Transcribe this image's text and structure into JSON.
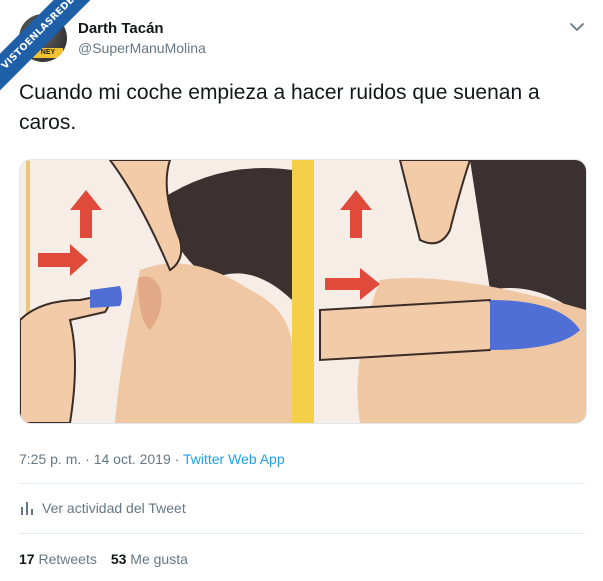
{
  "watermark": "VISTOENLASREDES",
  "user": {
    "name": "Darth Tacán",
    "handle": "@SuperManuMolina",
    "avatar_tag": "NEY"
  },
  "tweet": {
    "text": "Cuando mi coche empieza a hacer ruidos que suenan a caros."
  },
  "meta": {
    "time_date": "7:25 p. m. · 14 oct. 2019 · ",
    "app": "Twitter Web App"
  },
  "activity_label": "Ver actividad del Tweet",
  "stats": {
    "retweets_count": "17",
    "retweets_label": "Retweets",
    "likes_count": "53",
    "likes_label": "Me gusta"
  },
  "icons": [
    "chevron-down-icon",
    "bar-chart-icon",
    "arrow-up-icon",
    "arrow-right-icon"
  ],
  "colors": {
    "link": "#1da1f2",
    "secondary": "#657786",
    "ribbon": "#1f5fa8"
  }
}
